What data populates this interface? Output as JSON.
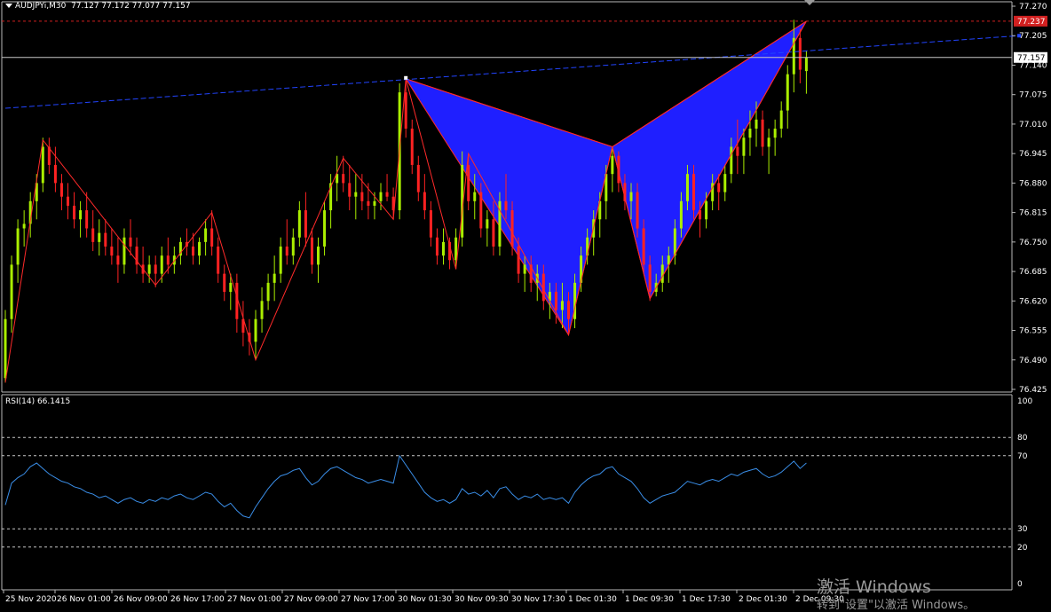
{
  "header": {
    "symbol": "AUDJPYi,M30",
    "ohlc": "77.127 77.172 77.077 77.157"
  },
  "rsi_panel": {
    "label": "RSI(14) 66.1415"
  },
  "watermark": {
    "line1": "激活 Windows",
    "line2": "转到\"设置\"以激活 Windows。"
  },
  "colors": {
    "background": "#000000",
    "bull_candle": "#aaee00",
    "bear_candle": "#ff2222",
    "pattern_fill": "#1f1fff",
    "pattern_line": "#ff2a2a",
    "trendline": "#2244ff",
    "rsi_line": "#3a8ee8",
    "bid_line": "#c8c8c8",
    "high_line": "#d22020"
  },
  "chart_data": [
    {
      "type": "candlestick",
      "symbol": "AUDJPYi",
      "timeframe": "M30",
      "ylim": [
        76.425,
        77.27
      ],
      "y_ticks": [
        "77.270",
        "77.205",
        "77.140",
        "77.075",
        "77.010",
        "76.945",
        "76.880",
        "76.815",
        "76.750",
        "76.685",
        "76.620",
        "76.555",
        "76.490",
        "76.425"
      ],
      "price_labels": [
        {
          "value": 77.237,
          "text": "77.237",
          "kind": "high"
        },
        {
          "value": 77.157,
          "text": "77.157",
          "kind": "bid"
        }
      ],
      "x_labels": [
        "25 Nov 2020",
        "26 Nov 01:00",
        "26 Nov 09:00",
        "26 Nov 17:00",
        "27 Nov 01:00",
        "27 Nov 09:00",
        "27 Nov 17:00",
        "30 Nov 01:30",
        "30 Nov 09:30",
        "30 Nov 17:30",
        "1 Dec 01:30",
        "1 Dec 09:30",
        "1 Dec 17:30",
        "2 Dec 01:30",
        "2 Dec 09:30"
      ],
      "zigzag": [
        {
          "bar": 0,
          "price": 76.44
        },
        {
          "bar": 6,
          "price": 76.975
        },
        {
          "bar": 24,
          "price": 76.655
        },
        {
          "bar": 33,
          "price": 76.815
        },
        {
          "bar": 40,
          "price": 76.49
        },
        {
          "bar": 54,
          "price": 76.935
        },
        {
          "bar": 62,
          "price": 76.8
        },
        {
          "bar": 64,
          "price": 77.11
        },
        {
          "bar": 72,
          "price": 76.69
        },
        {
          "bar": 74,
          "price": 76.945
        },
        {
          "bar": 90,
          "price": 76.545
        },
        {
          "bar": 97,
          "price": 76.96
        },
        {
          "bar": 103,
          "price": 76.625
        },
        {
          "bar": 128,
          "price": 77.237
        }
      ],
      "harmonic_pattern": [
        {
          "bar": 64,
          "price": 77.11
        },
        {
          "bar": 90,
          "price": 76.545
        },
        {
          "bar": 97,
          "price": 76.96
        },
        {
          "bar": 103,
          "price": 76.625
        },
        {
          "bar": 128,
          "price": 77.237
        }
      ],
      "trendline": [
        {
          "bar": 0,
          "price": 77.045
        },
        {
          "bar": 162,
          "price": 77.205
        }
      ],
      "candles": [
        [
          76.45,
          76.6,
          76.44,
          76.58
        ],
        [
          76.58,
          76.72,
          76.55,
          76.7
        ],
        [
          76.7,
          76.8,
          76.66,
          76.78
        ],
        [
          76.78,
          76.82,
          76.74,
          76.79
        ],
        [
          76.79,
          76.86,
          76.76,
          76.84
        ],
        [
          76.84,
          76.9,
          76.8,
          76.88
        ],
        [
          76.88,
          76.98,
          76.86,
          76.96
        ],
        [
          76.96,
          76.98,
          76.9,
          76.92
        ],
        [
          76.92,
          76.96,
          76.86,
          76.88
        ],
        [
          76.88,
          76.9,
          76.82,
          76.85
        ],
        [
          76.85,
          76.88,
          76.8,
          76.83
        ],
        [
          76.83,
          76.86,
          76.78,
          76.8
        ],
        [
          76.8,
          76.84,
          76.76,
          76.82
        ],
        [
          76.82,
          76.86,
          76.76,
          76.78
        ],
        [
          76.78,
          76.82,
          76.73,
          76.75
        ],
        [
          76.75,
          76.8,
          76.72,
          76.77
        ],
        [
          76.77,
          76.8,
          76.72,
          76.74
        ],
        [
          76.74,
          76.78,
          76.7,
          76.72
        ],
        [
          76.72,
          76.76,
          76.66,
          76.7
        ],
        [
          76.7,
          76.78,
          76.68,
          76.76
        ],
        [
          76.76,
          76.8,
          76.72,
          76.74
        ],
        [
          76.74,
          76.76,
          76.68,
          76.7
        ],
        [
          76.7,
          76.74,
          76.66,
          76.68
        ],
        [
          76.68,
          76.72,
          76.66,
          76.7
        ],
        [
          76.7,
          76.72,
          76.65,
          76.68
        ],
        [
          76.68,
          76.74,
          76.66,
          76.72
        ],
        [
          76.72,
          76.76,
          76.68,
          76.7
        ],
        [
          76.7,
          76.74,
          76.68,
          76.72
        ],
        [
          76.72,
          76.76,
          76.7,
          76.75
        ],
        [
          76.75,
          76.78,
          76.72,
          76.74
        ],
        [
          76.74,
          76.77,
          76.7,
          76.72
        ],
        [
          76.72,
          76.76,
          76.7,
          76.75
        ],
        [
          76.75,
          76.8,
          76.72,
          76.78
        ],
        [
          76.78,
          76.82,
          76.72,
          76.74
        ],
        [
          76.74,
          76.76,
          76.66,
          76.68
        ],
        [
          76.68,
          76.7,
          76.62,
          76.64
        ],
        [
          76.64,
          76.68,
          76.6,
          76.66
        ],
        [
          76.66,
          76.68,
          76.55,
          76.58
        ],
        [
          76.58,
          76.62,
          76.52,
          76.55
        ],
        [
          76.55,
          76.58,
          76.5,
          76.53
        ],
        [
          76.53,
          76.6,
          76.49,
          76.58
        ],
        [
          76.58,
          76.65,
          76.55,
          76.62
        ],
        [
          76.62,
          76.68,
          76.6,
          76.66
        ],
        [
          76.66,
          76.72,
          76.62,
          76.68
        ],
        [
          76.68,
          76.76,
          76.66,
          76.74
        ],
        [
          76.74,
          76.8,
          76.7,
          76.72
        ],
        [
          76.72,
          76.78,
          76.7,
          76.76
        ],
        [
          76.76,
          76.84,
          76.74,
          76.82
        ],
        [
          76.82,
          76.86,
          76.74,
          76.76
        ],
        [
          76.76,
          76.78,
          76.68,
          76.7
        ],
        [
          76.7,
          76.76,
          76.66,
          76.74
        ],
        [
          76.74,
          76.84,
          76.72,
          76.82
        ],
        [
          76.82,
          76.9,
          76.78,
          76.88
        ],
        [
          76.88,
          76.94,
          76.84,
          76.9
        ],
        [
          76.9,
          76.94,
          76.86,
          76.88
        ],
        [
          76.88,
          76.92,
          76.82,
          76.85
        ],
        [
          76.85,
          76.9,
          76.8,
          76.86
        ],
        [
          76.86,
          76.9,
          76.82,
          76.84
        ],
        [
          76.84,
          76.88,
          76.8,
          76.83
        ],
        [
          76.83,
          76.86,
          76.8,
          76.84
        ],
        [
          76.84,
          76.88,
          76.82,
          76.86
        ],
        [
          76.86,
          76.9,
          76.84,
          76.85
        ],
        [
          76.85,
          76.87,
          76.8,
          76.82
        ],
        [
          76.82,
          77.1,
          76.8,
          77.08
        ],
        [
          77.08,
          77.11,
          76.98,
          77.0
        ],
        [
          77.0,
          77.02,
          76.9,
          76.92
        ],
        [
          76.92,
          76.94,
          76.84,
          76.86
        ],
        [
          76.86,
          76.9,
          76.8,
          76.82
        ],
        [
          76.82,
          76.84,
          76.74,
          76.76
        ],
        [
          76.76,
          76.78,
          76.7,
          76.72
        ],
        [
          76.72,
          76.78,
          76.7,
          76.75
        ],
        [
          76.75,
          76.76,
          76.69,
          76.71
        ],
        [
          76.71,
          76.78,
          76.69,
          76.76
        ],
        [
          76.76,
          76.95,
          76.74,
          76.92
        ],
        [
          76.92,
          76.94,
          76.82,
          76.84
        ],
        [
          76.84,
          76.9,
          76.8,
          76.86
        ],
        [
          76.86,
          76.88,
          76.76,
          76.78
        ],
        [
          76.78,
          76.82,
          76.74,
          76.8
        ],
        [
          76.8,
          76.84,
          76.72,
          76.74
        ],
        [
          76.74,
          76.86,
          76.72,
          76.84
        ],
        [
          76.84,
          76.9,
          76.8,
          76.82
        ],
        [
          76.82,
          76.84,
          76.72,
          76.74
        ],
        [
          76.74,
          76.76,
          76.66,
          76.68
        ],
        [
          76.68,
          76.72,
          76.64,
          76.7
        ],
        [
          76.7,
          76.72,
          76.64,
          76.66
        ],
        [
          76.66,
          76.7,
          76.62,
          76.68
        ],
        [
          76.68,
          76.7,
          76.6,
          76.62
        ],
        [
          76.62,
          76.66,
          76.58,
          76.64
        ],
        [
          76.64,
          76.66,
          76.57,
          76.6
        ],
        [
          76.6,
          76.66,
          76.56,
          76.62
        ],
        [
          76.62,
          76.64,
          76.545,
          76.58
        ],
        [
          76.58,
          76.68,
          76.56,
          76.66
        ],
        [
          76.66,
          76.74,
          76.64,
          76.72
        ],
        [
          76.72,
          76.78,
          76.7,
          76.76
        ],
        [
          76.76,
          76.82,
          76.72,
          76.8
        ],
        [
          76.8,
          76.86,
          76.76,
          76.84
        ],
        [
          76.84,
          76.92,
          76.8,
          76.9
        ],
        [
          76.9,
          76.96,
          76.86,
          76.94
        ],
        [
          76.94,
          76.95,
          76.86,
          76.88
        ],
        [
          76.88,
          76.9,
          76.82,
          76.84
        ],
        [
          76.84,
          76.88,
          76.8,
          76.86
        ],
        [
          76.86,
          76.88,
          76.76,
          76.78
        ],
        [
          76.78,
          76.8,
          76.68,
          76.7
        ],
        [
          76.7,
          76.72,
          76.62,
          76.64
        ],
        [
          76.64,
          76.68,
          76.63,
          76.66
        ],
        [
          76.66,
          76.72,
          76.64,
          76.7
        ],
        [
          76.7,
          76.74,
          76.66,
          76.72
        ],
        [
          76.72,
          76.8,
          76.7,
          76.78
        ],
        [
          76.78,
          76.86,
          76.76,
          76.84
        ],
        [
          76.84,
          76.92,
          76.82,
          76.9
        ],
        [
          76.9,
          76.92,
          76.8,
          76.82
        ],
        [
          76.82,
          76.84,
          76.76,
          76.8
        ],
        [
          76.8,
          76.86,
          76.78,
          76.84
        ],
        [
          76.84,
          76.9,
          76.82,
          76.88
        ],
        [
          76.88,
          76.9,
          76.82,
          76.86
        ],
        [
          76.86,
          76.92,
          76.84,
          76.9
        ],
        [
          76.9,
          76.98,
          76.88,
          76.96
        ],
        [
          76.96,
          77.02,
          76.9,
          76.94
        ],
        [
          76.94,
          77.0,
          76.9,
          76.98
        ],
        [
          76.98,
          77.04,
          76.94,
          77.0
        ],
        [
          77.0,
          77.06,
          76.96,
          77.02
        ],
        [
          77.02,
          77.04,
          76.94,
          76.96
        ],
        [
          76.96,
          77.0,
          76.9,
          76.98
        ],
        [
          76.98,
          77.02,
          76.94,
          77.0
        ],
        [
          77.0,
          77.06,
          76.98,
          77.04
        ],
        [
          77.04,
          77.14,
          77.0,
          77.12
        ],
        [
          77.12,
          77.24,
          77.08,
          77.2
        ],
        [
          77.2,
          77.22,
          77.1,
          77.13
        ],
        [
          77.127,
          77.172,
          77.077,
          77.157
        ]
      ]
    },
    {
      "type": "line",
      "name": "RSI(14)",
      "value": 66.1415,
      "ylim": [
        0,
        100
      ],
      "y_ticks": [
        "100",
        "80",
        "70",
        "30",
        "20",
        "0"
      ],
      "levels": [
        80,
        70,
        30,
        20
      ],
      "values": [
        43,
        55,
        58,
        60,
        64,
        66,
        63,
        60,
        58,
        56,
        55,
        53,
        52,
        50,
        49,
        47,
        48,
        46,
        44,
        46,
        47,
        45,
        44,
        46,
        45,
        47,
        46,
        48,
        49,
        47,
        46,
        48,
        50,
        49,
        45,
        42,
        44,
        40,
        37,
        36,
        42,
        47,
        52,
        56,
        59,
        60,
        62,
        63,
        58,
        54,
        56,
        60,
        63,
        64,
        62,
        60,
        58,
        57,
        55,
        56,
        57,
        56,
        55,
        70,
        65,
        60,
        55,
        50,
        47,
        45,
        46,
        44,
        46,
        52,
        49,
        50,
        48,
        51,
        47,
        52,
        53,
        49,
        46,
        48,
        47,
        49,
        46,
        47,
        46,
        47,
        44,
        50,
        54,
        57,
        59,
        60,
        63,
        64,
        60,
        58,
        56,
        52,
        47,
        44,
        46,
        48,
        49,
        50,
        53,
        56,
        55,
        54,
        56,
        57,
        56,
        58,
        60,
        59,
        61,
        62,
        63,
        60,
        58,
        59,
        61,
        64,
        67,
        63,
        66
      ]
    }
  ]
}
